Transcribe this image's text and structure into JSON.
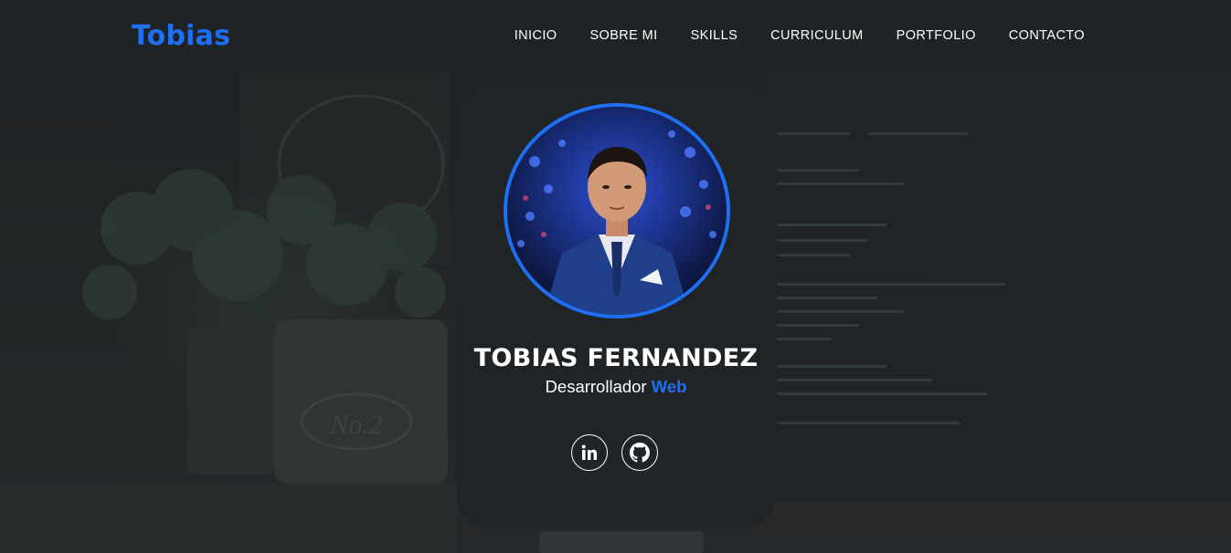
{
  "header": {
    "logo": "Tobias",
    "nav": [
      "INICIO",
      "SOBRE MI",
      "SKILLS",
      "CURRICULUM",
      "PORTFOLIO",
      "CONTACTO"
    ]
  },
  "profile": {
    "name": "TOBIAS FERNANDEZ",
    "role_prefix": "Desarrollador",
    "role_accent": "Web",
    "avatar_icon": "profile-photo"
  },
  "socials": [
    {
      "name": "linkedin",
      "icon": "linkedin-icon"
    },
    {
      "name": "github",
      "icon": "github-icon"
    }
  ],
  "background": {
    "pot_label": "No.2"
  },
  "colors": {
    "accent": "#1e6ff2",
    "header_bg": "#202325",
    "card_bg": "#202426",
    "text": "#ffffff"
  }
}
